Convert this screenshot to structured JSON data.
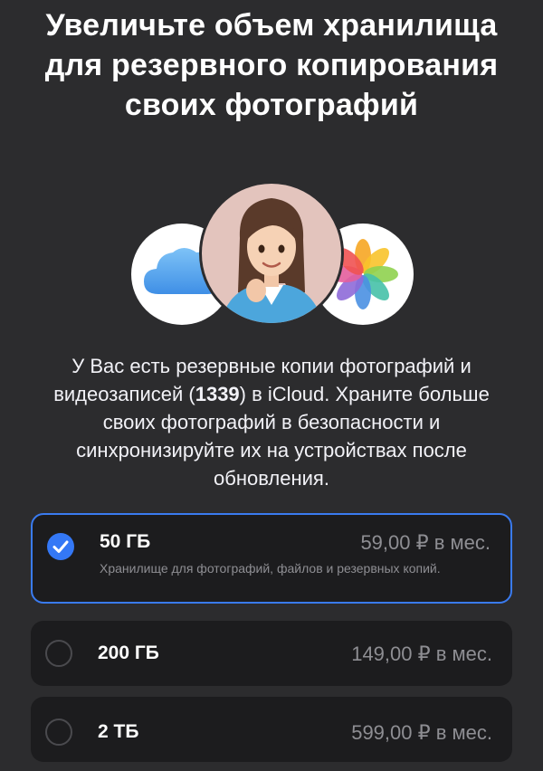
{
  "header": {
    "title": "Увеличьте объем хранилища для резервного копирования своих фотографий"
  },
  "hero": {
    "icons": [
      "icloud-icon",
      "memoji-avatar",
      "photos-icon"
    ]
  },
  "description": {
    "line1_pre": "У Вас есть резервные копии фотографий и видеозаписей (",
    "count": "1339",
    "line1_post": ") в iCloud. Храните больше своих фотографий в безопасности и синхронизируйте их на устройствах после обновления."
  },
  "plans": [
    {
      "size": "50 ГБ",
      "price": "59,00 ₽ в мес.",
      "note": "Хранилище для фотографий, файлов и резервных копий.",
      "selected": true
    },
    {
      "size": "200 ГБ",
      "price": "149,00 ₽ в мес.",
      "selected": false
    },
    {
      "size": "2 ТБ",
      "price": "599,00 ₽ в мес.",
      "selected": false
    }
  ],
  "colors": {
    "background": "#2c2c2e",
    "card": "#1c1c1e",
    "accent": "#3478f6",
    "secondary_text": "#8e8e93"
  }
}
